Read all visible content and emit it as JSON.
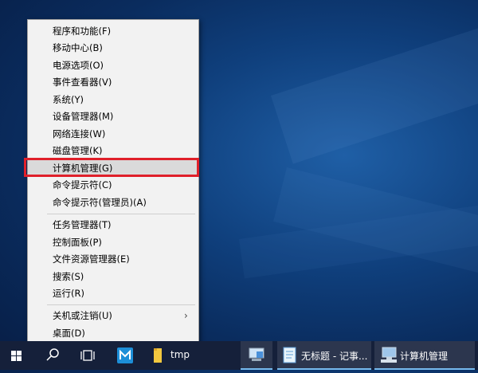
{
  "menu": {
    "groups": [
      [
        "程序和功能(F)",
        "移动中心(B)",
        "电源选项(O)",
        "事件查看器(V)",
        "系统(Y)",
        "设备管理器(M)",
        "网络连接(W)",
        "磁盘管理(K)",
        "计算机管理(G)",
        "命令提示符(C)",
        "命令提示符(管理员)(A)"
      ],
      [
        "任务管理器(T)",
        "控制面板(P)",
        "文件资源管理器(E)",
        "搜索(S)",
        "运行(R)"
      ],
      [
        "关机或注销(U)",
        "桌面(D)"
      ]
    ],
    "highlighted": "计算机管理(G)",
    "submenu_item": "关机或注销(U)"
  },
  "taskbar": {
    "items": [
      {
        "icon": "windows-start-icon"
      },
      {
        "icon": "search-icon"
      },
      {
        "icon": "task-view-icon"
      },
      {
        "icon": "maxthon-browser-icon"
      },
      {
        "icon": "folder-icon",
        "label": "tmp"
      },
      {
        "icon": "control-panel-icon"
      },
      {
        "icon": "notepad-icon",
        "label": "无标题 - 记事..."
      },
      {
        "icon": "computer-management-icon",
        "label": "计算机管理"
      }
    ]
  },
  "colors": {
    "highlight_box": "#e0202a",
    "menu_bg": "#f2f2f2",
    "taskbar_bg": "#15203a",
    "active_underline": "#76b9ed"
  }
}
